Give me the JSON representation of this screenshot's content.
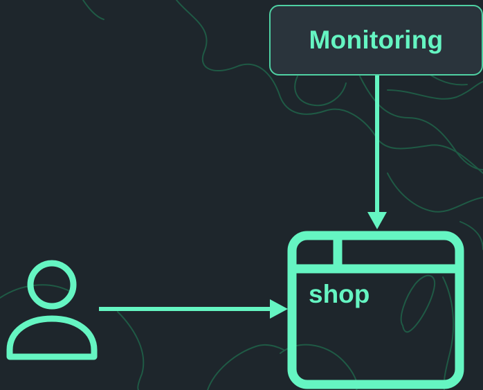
{
  "diagram": {
    "nodes": {
      "monitoring": {
        "label": "Monitoring"
      },
      "shop": {
        "label": "shop"
      }
    },
    "edges": [
      {
        "from": "monitoring",
        "to": "shop"
      },
      {
        "from": "user",
        "to": "shop"
      }
    ]
  },
  "icons": {
    "user": "user-icon",
    "shop": "browser-window-icon"
  },
  "colors": {
    "background": "#1e262c",
    "accent": "#65f5c2",
    "box_fill": "#2a343c",
    "contour": "#1f5a45"
  }
}
